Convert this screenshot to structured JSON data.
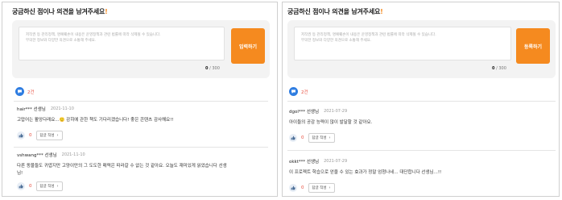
{
  "panels": [
    {
      "question_title": "궁금하신 점이나 의견을 남겨주세요",
      "question_mark": "!",
      "placeholder_lines": [
        "저작권 등 관리정책, 명예훼손이 내용은 운영정책과 관련 법률에 따라 삭제될 수 있습니다.",
        "무의한 정보와 다양한 의견으로 소통해 주세요."
      ],
      "char_count": "0",
      "char_max": "/ 300",
      "submit_label": "입력하기",
      "comment_count": "2건",
      "comments": [
        {
          "user": "hair*** 선생님",
          "date": "2021-11-10",
          "text": "고맙어는 활앙다래요...🙂 감히에 관한 책도 기다리겠습니다! 좋은 콘텐츠 감사해요!!",
          "likes": "0",
          "reply_label": "답글 작성"
        },
        {
          "user": "vshwang*** 선생님",
          "date": "2021-11-10",
          "text": "다른 동물들도 귀엽지만 고양이만의 그 도도한 매력은 따라갈 수 없는 것 같아요. 오늘도 재미있게 읽었습니다 선생님!",
          "likes": "0",
          "reply_label": "답글 작성"
        }
      ]
    },
    {
      "question_title": "궁금하신 점이나 의견을 남겨주세요",
      "question_mark": "!",
      "placeholder_lines": [
        "저작권 등 관리정책, 명예훼손이 내용은 운영정책과 관련 법률에 따라 삭제될 수 있습니다.",
        "무의한 정보와 다양한 의견으로 소통해 주세요."
      ],
      "char_count": "0",
      "char_max": "/ 300",
      "submit_label": "등록하기",
      "comment_count": "2건",
      "comments": [
        {
          "user": "dgol*** 선생님",
          "date": "2021-07-29",
          "text": "아이들의 공감 능력이 많이 발달할 것 같아요.",
          "likes": "0",
          "reply_label": "답글 작성"
        },
        {
          "user": "okkt*** 선생님",
          "date": "2021-07-29",
          "text": "이 프로젝트 학습으로 얻을 수 있는 효과가 정말 엄청나네... 대단합니다 선생님...!!",
          "likes": "0",
          "reply_label": "답글 작성"
        }
      ]
    }
  ]
}
